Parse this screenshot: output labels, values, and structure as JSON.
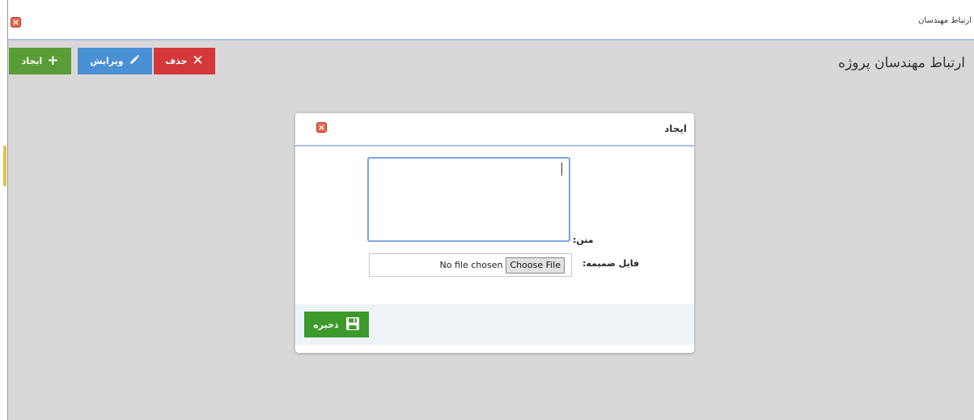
{
  "window": {
    "title": "ارتباط مهندسان"
  },
  "toolbar": {
    "create_label": "ایجاد",
    "edit_label": "ویرایش",
    "delete_label": "حذف"
  },
  "page": {
    "title": "ارتباط مهندسان پروژه"
  },
  "dialog": {
    "title": "ایجاد",
    "text_label": "متن:",
    "text_value": "",
    "file_label": "فایل ضمیمه:",
    "file_button": "Choose File",
    "file_status": "No file chosen",
    "save_label": "ذخیره"
  },
  "colors": {
    "create": "#5a9c35",
    "edit": "#4a90d4",
    "delete": "#d3393a",
    "save": "#3b9a2a",
    "accent_line": "#a9c1e6"
  },
  "icons": {
    "create": "plus-icon",
    "edit": "pencil-icon",
    "delete": "x-icon",
    "save": "floppy-disk-icon",
    "close": "close-icon"
  }
}
